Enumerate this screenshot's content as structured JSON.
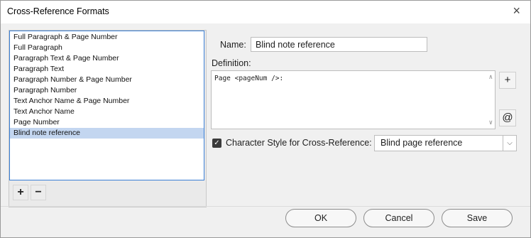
{
  "window": {
    "title": "Cross-Reference Formats",
    "close_glyph": "×"
  },
  "formats": {
    "items": [
      {
        "label": "Full Paragraph & Page Number"
      },
      {
        "label": "Full Paragraph"
      },
      {
        "label": "Paragraph Text & Page Number"
      },
      {
        "label": "Paragraph Text"
      },
      {
        "label": "Paragraph Number & Page Number"
      },
      {
        "label": "Paragraph Number"
      },
      {
        "label": "Text Anchor Name & Page Number"
      },
      {
        "label": "Text Anchor Name"
      },
      {
        "label": "Page Number"
      },
      {
        "label": "Blind note reference"
      }
    ],
    "selected_index": 9,
    "add_label": "+",
    "remove_label": "−"
  },
  "editor": {
    "name_label": "Name:",
    "name_value": "Blind note reference",
    "definition_label": "Definition:",
    "definition_value": "Page <pageNum />:",
    "insert_building_block_glyph": "+",
    "insert_special_char_glyph": "@",
    "char_style_checked": true,
    "char_style_label": "Character Style for Cross-Reference:",
    "char_style_value": "Blind page reference"
  },
  "buttons": {
    "ok": "OK",
    "cancel": "Cancel",
    "save": "Save"
  },
  "colors": {
    "selection": "#c3d6f0",
    "list_border": "#3a7fd5"
  }
}
